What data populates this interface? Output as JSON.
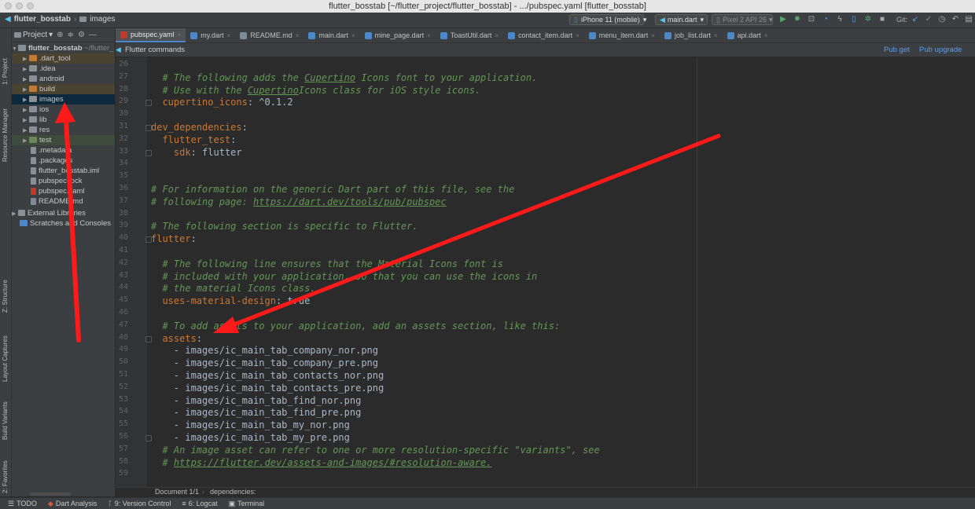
{
  "window": {
    "title": "flutter_bosstab [~/flutter_project/flutter_bosstab] - .../pubspec.yaml [flutter_bosstab]"
  },
  "nav": {
    "project": "flutter_bosstab",
    "folder": "images",
    "device": "iPhone 11 (mobile)",
    "run_config": "main.dart",
    "emulator": "Pixel 2 API 26",
    "git_label": "Git:"
  },
  "left_strip": {
    "tabs": [
      "1: Project",
      "Resource Manager",
      "Z: Structure",
      "Layout Captures",
      "Build Variants",
      "2: Favorites"
    ]
  },
  "project_panel": {
    "header": "Project",
    "root": {
      "name": "flutter_bosstab",
      "path": "~/flutter_"
    },
    "items": [
      {
        "label": ".dart_tool",
        "type": "folder-orange"
      },
      {
        "label": ".idea",
        "type": "folder"
      },
      {
        "label": "android",
        "type": "folder"
      },
      {
        "label": "build",
        "type": "folder-orange"
      },
      {
        "label": "images",
        "type": "folder"
      },
      {
        "label": "ios",
        "type": "folder"
      },
      {
        "label": "lib",
        "type": "folder"
      },
      {
        "label": "res",
        "type": "folder"
      },
      {
        "label": "test",
        "type": "folder-green"
      },
      {
        "label": ".metadata",
        "type": "file"
      },
      {
        "label": ".packages",
        "type": "file"
      },
      {
        "label": "flutter_bosstab.iml",
        "type": "file"
      },
      {
        "label": "pubspec.lock",
        "type": "file"
      },
      {
        "label": "pubspec.yaml",
        "type": "yaml"
      },
      {
        "label": "README.md",
        "type": "md"
      }
    ],
    "external": "External Libraries",
    "scratches": "Scratches and Consoles"
  },
  "editor_tabs": [
    "pubspec.yaml",
    "my.dart",
    "README.md",
    "main.dart",
    "mine_page.dart",
    "ToastUtil.dart",
    "contact_item.dart",
    "menu_item.dart",
    "job_list.dart",
    "api.dart"
  ],
  "commands": {
    "title": "Flutter commands",
    "pub_get": "Pub get",
    "pub_upgrade": "Pub upgrade"
  },
  "code": {
    "lines": [
      {
        "n": "26",
        "t": ""
      },
      {
        "n": "27",
        "t": "  # The following adds the Cupertino Icons font to your application."
      },
      {
        "n": "28",
        "t": "  # Use with the CupertinoIcons class for iOS style icons."
      },
      {
        "n": "29",
        "t": "  cupertino_icons: ^0.1.2"
      },
      {
        "n": "30",
        "t": ""
      },
      {
        "n": "31",
        "t": "dev_dependencies:"
      },
      {
        "n": "32",
        "t": "  flutter_test:"
      },
      {
        "n": "33",
        "t": "    sdk: flutter"
      },
      {
        "n": "34",
        "t": ""
      },
      {
        "n": "35",
        "t": ""
      },
      {
        "n": "36",
        "t": "# For information on the generic Dart part of this file, see the"
      },
      {
        "n": "37",
        "t": "# following page: https://dart.dev/tools/pub/pubspec"
      },
      {
        "n": "38",
        "t": ""
      },
      {
        "n": "39",
        "t": "# The following section is specific to Flutter."
      },
      {
        "n": "40",
        "t": "flutter:"
      },
      {
        "n": "41",
        "t": ""
      },
      {
        "n": "42",
        "t": "  # The following line ensures that the Material Icons font is"
      },
      {
        "n": "43",
        "t": "  # included with your application, so that you can use the icons in"
      },
      {
        "n": "44",
        "t": "  # the material Icons class."
      },
      {
        "n": "45",
        "t": "  uses-material-design: true"
      },
      {
        "n": "46",
        "t": ""
      },
      {
        "n": "47",
        "t": "  # To add assets to your application, add an assets section, like this:"
      },
      {
        "n": "48",
        "t": "  assets:"
      },
      {
        "n": "49",
        "t": "    - images/ic_main_tab_company_nor.png"
      },
      {
        "n": "50",
        "t": "    - images/ic_main_tab_company_pre.png"
      },
      {
        "n": "51",
        "t": "    - images/ic_main_tab_contacts_nor.png"
      },
      {
        "n": "52",
        "t": "    - images/ic_main_tab_contacts_pre.png"
      },
      {
        "n": "53",
        "t": "    - images/ic_main_tab_find_nor.png"
      },
      {
        "n": "54",
        "t": "    - images/ic_main_tab_find_pre.png"
      },
      {
        "n": "55",
        "t": "    - images/ic_main_tab_my_nor.png"
      },
      {
        "n": "56",
        "t": "    - images/ic_main_tab_my_pre.png"
      },
      {
        "n": "57",
        "t": "  # An image asset can refer to one or more resolution-specific \"variants\", see"
      },
      {
        "n": "58",
        "t": "  # https://flutter.dev/assets-and-images/#resolution-aware."
      },
      {
        "n": "59",
        "t": ""
      }
    ]
  },
  "status": {
    "document": "Document 1/1",
    "path": "dependencies:"
  },
  "bottom_tools": [
    "TODO",
    "Dart Analysis",
    "9: Version Control",
    "6: Logcat",
    "Terminal"
  ],
  "colors": {
    "comment": "#629755",
    "key": "#cc7832",
    "value": "#a9b7c6",
    "annotation": "#ff1a1a",
    "link": "#589df6"
  }
}
